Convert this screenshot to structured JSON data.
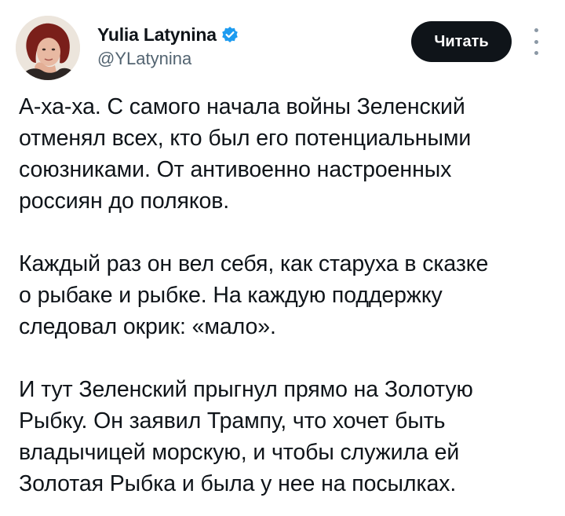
{
  "author": {
    "display_name": "Yulia Latynina",
    "handle": "@YLatynina",
    "verified": true,
    "verified_color": "#1d9bf0"
  },
  "actions": {
    "follow_label": "Читать",
    "more_icon": "more-vertical-icon"
  },
  "tweet": {
    "paragraphs": [
      "А-ха-ха. С самого начала войны Зеленский\nотменял всех, кто был его потенциальными\nсоюзниками. От антивоенно настроенных\nроссиян до поляков.",
      "Каждый раз он вел себя, как старуха в сказке\nо рыбаке и рыбке. На каждую поддержку\nследовал окрик: «мало».",
      "И тут Зеленский прыгнул прямо на Золотую\nРыбку. Он заявил Трампу, что хочет быть\nвладычицей морскую, и чтобы служила ей\nЗолотая Рыбка и была у нее на посылках."
    ]
  }
}
